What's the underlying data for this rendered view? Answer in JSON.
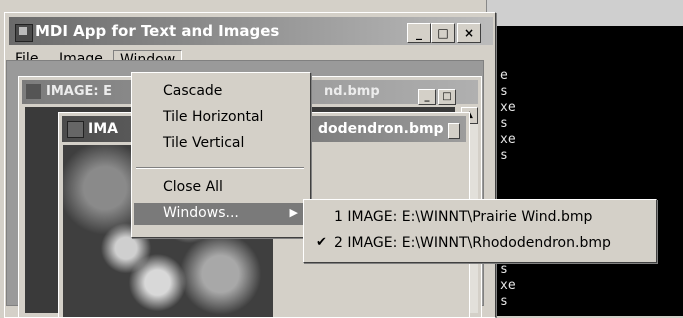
{
  "console": {
    "lines_top": [
      "e",
      "s",
      "xe",
      "s",
      "xe",
      "s"
    ],
    "lines_bottom": [
      "s",
      "xe",
      "s"
    ]
  },
  "app": {
    "title": "MDI App for Text and Images",
    "caption_buttons": {
      "minimize": "_",
      "maximize": "□",
      "close": "×"
    }
  },
  "menubar": {
    "items": [
      "File",
      "Image",
      "Window"
    ]
  },
  "child_windows": [
    {
      "title_visible_left": "IMAGE: E",
      "title_visible_right": "nd.bmp"
    },
    {
      "title_visible_left": "IMA",
      "title_visible_right": "dodendron.bmp"
    }
  ],
  "window_menu": {
    "items": [
      "Cascade",
      "Tile Horizontal",
      "Tile Vertical",
      "Close All",
      "Windows..."
    ],
    "submenu_arrow": "▶"
  },
  "windows_submenu": {
    "items": [
      {
        "label": "1 IMAGE: E:\\WINNT\\Prairie Wind.bmp",
        "checked": false,
        "mark": ""
      },
      {
        "label": "2 IMAGE: E:\\WINNT\\Rhododendron.bmp",
        "checked": true,
        "mark": "✔"
      }
    ]
  }
}
